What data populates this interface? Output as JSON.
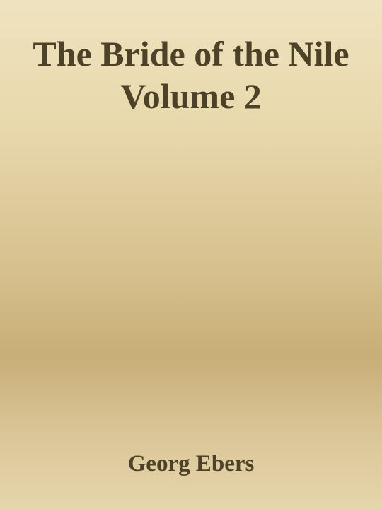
{
  "cover": {
    "title": "The Bride of the Nile Volume 2",
    "author": "Georg Ebers"
  }
}
